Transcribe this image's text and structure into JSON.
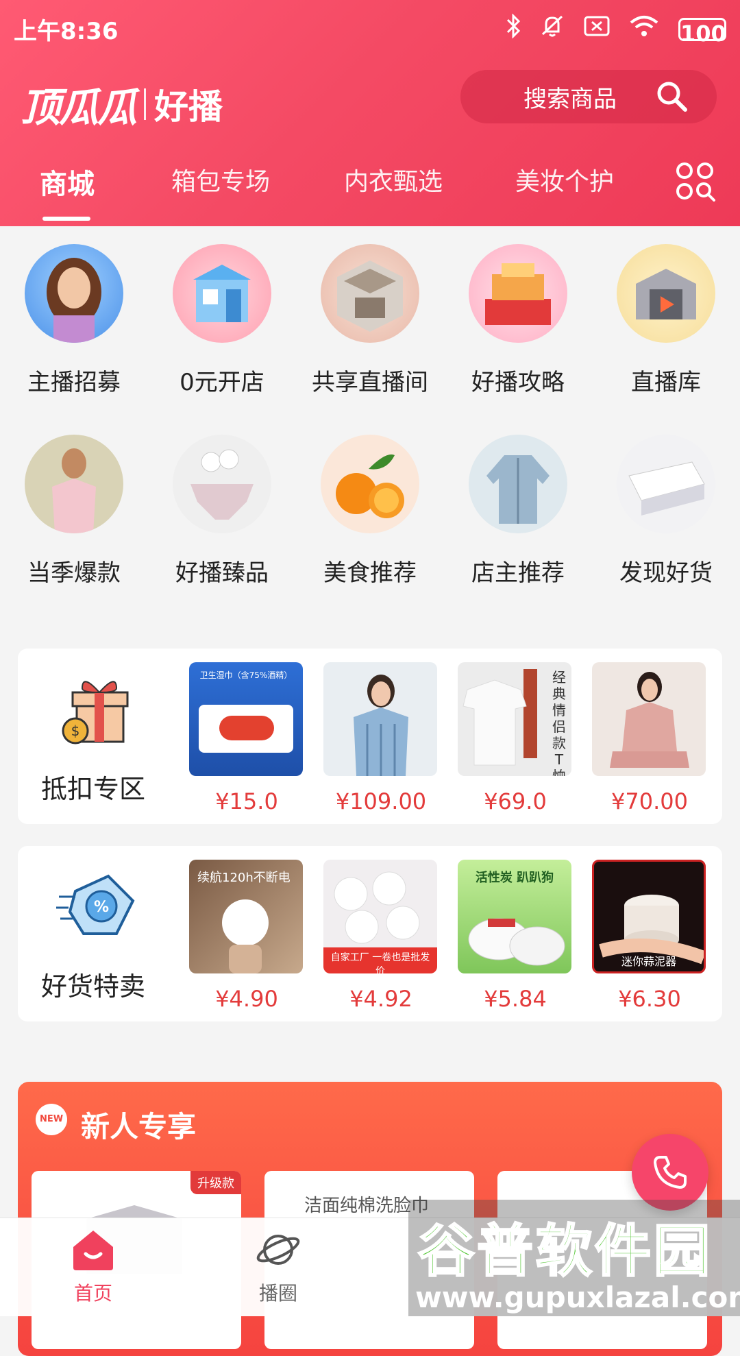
{
  "status_bar": {
    "time": "上午8:36",
    "battery": "100"
  },
  "brand": {
    "logo": "顶瓜瓜",
    "name": "好播"
  },
  "search": {
    "placeholder": "搜索商品"
  },
  "tabs": [
    {
      "label": "商城"
    },
    {
      "label": "箱包专场"
    },
    {
      "label": "内衣甄选"
    },
    {
      "label": "美妆个护"
    }
  ],
  "categories_row1": [
    {
      "label": "主播招募",
      "icon": "host-recruit-icon"
    },
    {
      "label": "0元开店",
      "icon": "store-icon"
    },
    {
      "label": "共享直播间",
      "icon": "live-room-icon"
    },
    {
      "label": "好播攻略",
      "icon": "guide-icon"
    },
    {
      "label": "直播库",
      "icon": "warehouse-icon"
    }
  ],
  "categories_row2": [
    {
      "label": "当季爆款",
      "icon": "tshirt-model-icon"
    },
    {
      "label": "好播臻品",
      "icon": "underwear-icon"
    },
    {
      "label": "美食推荐",
      "icon": "orange-icon"
    },
    {
      "label": "店主推荐",
      "icon": "jacket-icon"
    },
    {
      "label": "发现好货",
      "icon": "tissue-icon"
    }
  ],
  "deduction_zone": {
    "title": "抵扣专区",
    "products": [
      {
        "price": "¥15.0",
        "caption": "卫生湿巾（含75%酒精）"
      },
      {
        "price": "¥109.00",
        "caption": ""
      },
      {
        "price": "¥69.0",
        "caption": "经典情侣款T恤"
      },
      {
        "price": "¥70.00",
        "caption": ""
      }
    ]
  },
  "special_sale": {
    "title": "好货特卖",
    "products": [
      {
        "price": "¥4.90",
        "caption": "续航120h不断电"
      },
      {
        "price": "¥4.92",
        "caption": "自家工厂 一卷也是批发价"
      },
      {
        "price": "¥5.84",
        "caption": "活性炭 趴趴狗"
      },
      {
        "price": "¥6.30",
        "caption": "迷你蒜泥器"
      }
    ]
  },
  "new_user": {
    "title": "新人专享",
    "badge": "NEW",
    "items": [
      {
        "tag": "升级款"
      },
      {
        "caption": "洁面纯棉洗脸巾"
      }
    ]
  },
  "bottom_nav": [
    {
      "label": "首页"
    },
    {
      "label": "播圈"
    }
  ],
  "watermark": {
    "line1": "谷普软件园",
    "line2": "www.gupuxlazal.com"
  },
  "colors": {
    "accent": "#f0415d",
    "price": "#e33b3b",
    "header": "#f44a64"
  }
}
